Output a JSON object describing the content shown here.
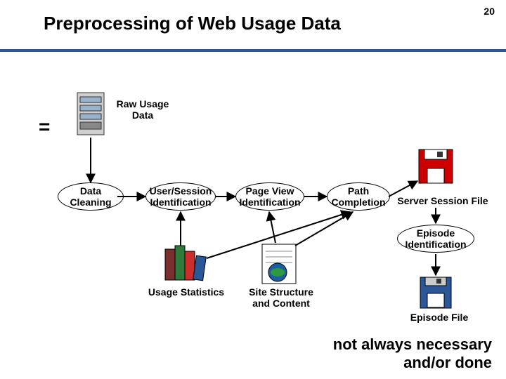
{
  "header": {
    "title": "Preprocessing of Web Usage Data",
    "pagenum": "20"
  },
  "eq": "=",
  "raw_usage_data": "Raw Usage\nData",
  "steps": {
    "data_cleaning": "Data\nCleaning",
    "user_session": "User/Session\nIdentification",
    "page_view": "Page View\nIdentification",
    "path_completion": "Path\nCompletion",
    "server_session_file": "Server Session File",
    "episode_identification": "Episode\nIdentification",
    "usage_statistics": "Usage Statistics",
    "site_structure": "Site Structure\nand Content",
    "episode_file": "Episode File"
  },
  "footnote": {
    "line1": "not always necessary",
    "line2": "and/or done"
  },
  "chart_data": {
    "type": "diagram",
    "title": "Preprocessing of Web Usage Data",
    "nodes": [
      {
        "id": "raw",
        "label": "Raw Usage Data",
        "kind": "icon-server"
      },
      {
        "id": "clean",
        "label": "Data Cleaning",
        "kind": "process-ellipse"
      },
      {
        "id": "user_session",
        "label": "User/Session Identification",
        "kind": "process-ellipse"
      },
      {
        "id": "page_view",
        "label": "Page View Identification",
        "kind": "process-ellipse"
      },
      {
        "id": "path_completion",
        "label": "Path Completion",
        "kind": "process-ellipse"
      },
      {
        "id": "server_session_file",
        "label": "Server Session File",
        "kind": "icon-disk"
      },
      {
        "id": "episode_identification",
        "label": "Episode Identification",
        "kind": "process-ellipse"
      },
      {
        "id": "episode_file",
        "label": "Episode File",
        "kind": "icon-disk"
      },
      {
        "id": "usage_stats",
        "label": "Usage Statistics",
        "kind": "icon-books"
      },
      {
        "id": "site_structure",
        "label": "Site Structure and Content",
        "kind": "icon-document-globe"
      }
    ],
    "edges": [
      [
        "raw",
        "clean"
      ],
      [
        "clean",
        "user_session"
      ],
      [
        "user_session",
        "page_view"
      ],
      [
        "page_view",
        "path_completion"
      ],
      [
        "path_completion",
        "server_session_file"
      ],
      [
        "server_session_file",
        "episode_identification"
      ],
      [
        "episode_identification",
        "episode_file"
      ],
      [
        "usage_stats",
        "user_session"
      ],
      [
        "usage_stats",
        "path_completion"
      ],
      [
        "site_structure",
        "page_view"
      ],
      [
        "site_structure",
        "path_completion"
      ]
    ],
    "annotations": [
      {
        "text": "not always necessary and/or done",
        "target": "episode_file"
      }
    ]
  }
}
